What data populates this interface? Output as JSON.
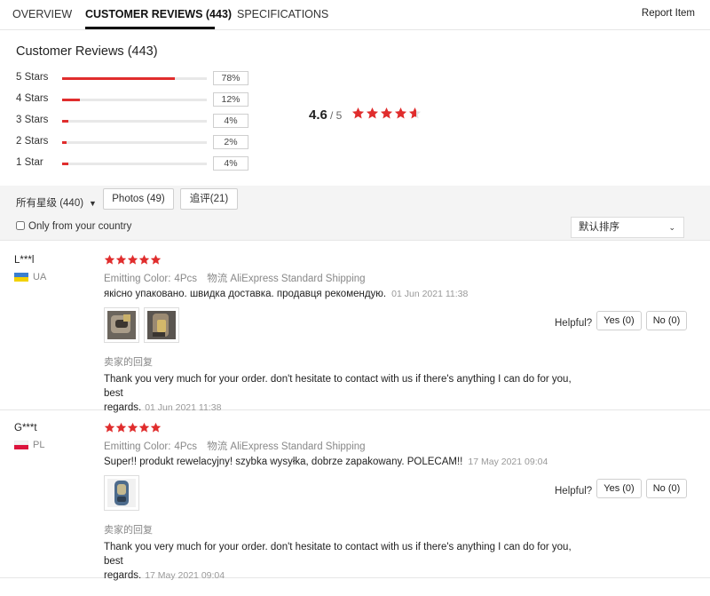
{
  "tabs": [
    {
      "label": "OVERVIEW"
    },
    {
      "label": "CUSTOMER REVIEWS (443)"
    },
    {
      "label": "SPECIFICATIONS"
    }
  ],
  "report_label": "Report Item",
  "summary": {
    "title": "Customer Reviews (443)",
    "rows": [
      {
        "label": "5 Stars",
        "pct": "78%",
        "value": 0.78
      },
      {
        "label": "4 Stars",
        "pct": "12%",
        "value": 0.12
      },
      {
        "label": "3 Stars",
        "pct": "4%",
        "value": 0.04
      },
      {
        "label": "2 Stars",
        "pct": "2%",
        "value": 0.02
      },
      {
        "label": "1 Star",
        "pct": "4%",
        "value": 0.04
      }
    ],
    "average": "4.6",
    "out_of": "/ 5",
    "average_rating": 4.6
  },
  "filters": {
    "all_label": "所有星级 (440)",
    "photos_label": "Photos (49)",
    "followup_label": "追评(21)",
    "country_label": "Only from your country",
    "sort_label": "默认排序"
  },
  "colors": {
    "accent": "#e02d2d",
    "star": "#e02d2d"
  },
  "reviews": [
    {
      "name": "L***l",
      "country": "UA",
      "rating": 5,
      "meta_label": "Emitting Color:",
      "meta_value": "4Pcs",
      "logistics_label": "物流",
      "shipping": "AliExpress Standard Shipping",
      "text": "якісно упаковано. швидка доставка. продавця рекомендую.",
      "date": "01 Jun 2021 11:38",
      "helpful_label": "Helpful?",
      "yes_label": "Yes (0)",
      "no_label": "No (0)",
      "reply_title": "卖家的回复",
      "reply_line1": "Thank you very much for your order. don't hesitate to contact with us if there's anything I can do for you, best",
      "reply_line2": "regards.",
      "reply_date": "01 Jun 2021 11:38"
    },
    {
      "name": "G***t",
      "country": "PL",
      "rating": 5,
      "meta_label": "Emitting Color:",
      "meta_value": "4Pcs",
      "logistics_label": "物流",
      "shipping": "AliExpress Standard Shipping",
      "text": "Super!! produkt rewelacyjny! szybka wysyłka, dobrze zapakowany. POLECAM!!",
      "date": "17 May 2021 09:04",
      "helpful_label": "Helpful?",
      "yes_label": "Yes (0)",
      "no_label": "No (0)",
      "reply_title": "卖家的回复",
      "reply_line1": "Thank you very much for your order. don't hesitate to contact with us if there's anything I can do for you, best",
      "reply_line2": "regards.",
      "reply_date": "17 May 2021 09:04"
    }
  ]
}
